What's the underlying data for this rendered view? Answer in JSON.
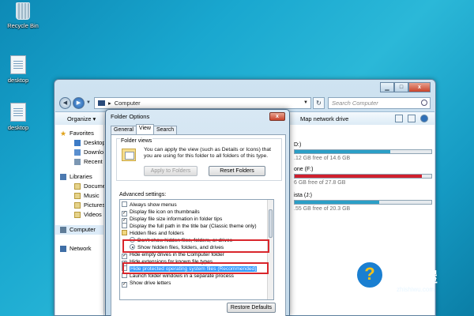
{
  "desktop": {
    "icons": [
      {
        "label": "Recycle Bin"
      },
      {
        "label": "desktop"
      },
      {
        "label": "desktop"
      }
    ]
  },
  "explorer": {
    "address": "Computer",
    "search_placeholder": "Search Computer",
    "toolbar": {
      "organize": "Organize ▾",
      "map_drive": "Map network drive"
    },
    "nav": {
      "favorites": "Favorites",
      "fav_items": [
        "Desktop",
        "Downlo",
        "Recent P"
      ],
      "libraries": "Libraries",
      "lib_items": [
        "Docume",
        "Music",
        "Pictures",
        "Videos"
      ],
      "computer": "Computer",
      "network": "Network"
    },
    "drives": [
      {
        "name": "D:)",
        "free": ".12 GB free of 14.6 GB",
        "used_fraction": 0.7,
        "color": "#2b9fc7"
      },
      {
        "name": "one (F:)",
        "free": "6 GB free of 27.8 GB",
        "used_fraction": 0.93,
        "color": "#d0202e"
      },
      {
        "name": "ista (J:)",
        "free": ".55 GB free of 20.3 GB",
        "used_fraction": 0.62,
        "color": "#2b9fc7"
      }
    ]
  },
  "dialog": {
    "title": "Folder Options",
    "close": "x",
    "tabs": [
      "General",
      "View",
      "Search"
    ],
    "active_tab": "View",
    "folder_views": {
      "legend": "Folder views",
      "description": "You can apply the view (such as Details or Icons) that you are using for this folder to all folders of this type.",
      "apply_button": "Apply to Folders",
      "reset_button": "Reset Folders"
    },
    "advanced_label": "Advanced settings:",
    "settings": [
      {
        "kind": "checkbox",
        "checked": false,
        "text": "Always show menus"
      },
      {
        "kind": "checkbox",
        "checked": true,
        "text": "Display file icon on thumbnails"
      },
      {
        "kind": "checkbox",
        "checked": true,
        "text": "Display file size information in folder tips"
      },
      {
        "kind": "checkbox",
        "checked": false,
        "text": "Display the full path in the title bar (Classic theme only)"
      },
      {
        "kind": "folder",
        "text": "Hidden files and folders"
      },
      {
        "kind": "radio",
        "checked": false,
        "text": "Don't show hidden files, folders, or drives"
      },
      {
        "kind": "radio",
        "checked": true,
        "text": "Show hidden files, folders, and drives"
      },
      {
        "kind": "checkbox",
        "checked": true,
        "text": "Hide empty drives in the Computer folder"
      },
      {
        "kind": "checkbox",
        "checked": true,
        "text": "Hide extensions for known file types"
      },
      {
        "kind": "checkbox",
        "checked": false,
        "text": "Hide protected operating system files (Recommended)"
      },
      {
        "kind": "checkbox",
        "checked": false,
        "text": "Launch folder windows in a separate process"
      },
      {
        "kind": "checkbox",
        "checked": true,
        "text": "Show drive letters"
      }
    ],
    "restore_button": "Restore Defaults"
  },
  "watermark": {
    "logo_glyph": "?",
    "title": "知识屋",
    "subtitle": "zhishiwu.com"
  },
  "colors": {
    "highlight_box": "#d9262c",
    "selection": "#3399ff"
  }
}
